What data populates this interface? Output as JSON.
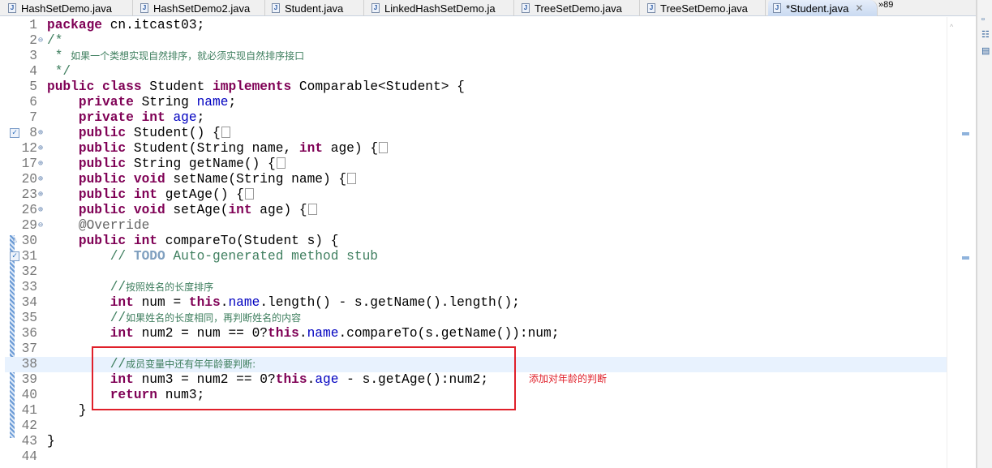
{
  "tabs": [
    {
      "label": "HashSetDemo.java",
      "active": false
    },
    {
      "label": "HashSetDemo2.java",
      "active": false
    },
    {
      "label": "Student.java",
      "active": false
    },
    {
      "label": "LinkedHashSetDemo.ja",
      "active": false
    },
    {
      "label": "TreeSetDemo.java",
      "active": false
    },
    {
      "label": "TreeSetDemo.java",
      "active": false
    },
    {
      "label": "*Student.java",
      "active": true
    }
  ],
  "overflow": {
    "chevron": "»",
    "count": "89"
  },
  "annotation": "添加对年龄的判断",
  "colors": {
    "highlight_box": "#e0202a",
    "keyword": "#7f0055",
    "comment": "#3f7f5f",
    "field": "#0000c0"
  },
  "lines": [
    {
      "num": "1",
      "seg": [
        [
          "kw",
          "package"
        ],
        [
          "pl",
          " cn.itcast03;"
        ]
      ]
    },
    {
      "num": "2",
      "fold": "minus",
      "seg": [
        [
          "cm",
          "/*"
        ]
      ]
    },
    {
      "num": "3",
      "seg": [
        [
          "cm",
          " * "
        ],
        [
          "cn",
          "如果一个类想实现自然排序，就必须实现自然排序接口"
        ]
      ]
    },
    {
      "num": "4",
      "seg": [
        [
          "cm",
          " */"
        ]
      ]
    },
    {
      "num": "5",
      "seg": [
        [
          "kw",
          "public class"
        ],
        [
          "pl",
          " Student "
        ],
        [
          "kw",
          "implements"
        ],
        [
          "pl",
          " Comparable<Student> {"
        ]
      ]
    },
    {
      "num": "6",
      "seg": [
        [
          "pl",
          "    "
        ],
        [
          "kw",
          "private"
        ],
        [
          "pl",
          " String "
        ],
        [
          "fld",
          "name"
        ],
        [
          "pl",
          ";"
        ]
      ]
    },
    {
      "num": "7",
      "seg": [
        [
          "pl",
          "    "
        ],
        [
          "kw",
          "private int"
        ],
        [
          "pl",
          " "
        ],
        [
          "fld",
          "age"
        ],
        [
          "pl",
          ";"
        ]
      ]
    },
    {
      "num": "8",
      "fold": "plus",
      "marker": "check",
      "seg": [
        [
          "pl",
          "    "
        ],
        [
          "kw",
          "public"
        ],
        [
          "pl",
          " Student() {"
        ],
        [
          "box",
          ""
        ]
      ]
    },
    {
      "num": "12",
      "fold": "plus",
      "seg": [
        [
          "pl",
          "    "
        ],
        [
          "kw",
          "public"
        ],
        [
          "pl",
          " Student(String name, "
        ],
        [
          "kw",
          "int"
        ],
        [
          "pl",
          " age) {"
        ],
        [
          "box",
          ""
        ]
      ]
    },
    {
      "num": "17",
      "fold": "plus",
      "seg": [
        [
          "pl",
          "    "
        ],
        [
          "kw",
          "public"
        ],
        [
          "pl",
          " String getName() {"
        ],
        [
          "box",
          ""
        ]
      ]
    },
    {
      "num": "20",
      "fold": "plus",
      "seg": [
        [
          "pl",
          "    "
        ],
        [
          "kw",
          "public void"
        ],
        [
          "pl",
          " setName(String name) {"
        ],
        [
          "box",
          ""
        ]
      ]
    },
    {
      "num": "23",
      "fold": "plus",
      "seg": [
        [
          "pl",
          "    "
        ],
        [
          "kw",
          "public int"
        ],
        [
          "pl",
          " getAge() {"
        ],
        [
          "box",
          ""
        ]
      ]
    },
    {
      "num": "26",
      "fold": "plus",
      "seg": [
        [
          "pl",
          "    "
        ],
        [
          "kw",
          "public void"
        ],
        [
          "pl",
          " setAge("
        ],
        [
          "kw",
          "int"
        ],
        [
          "pl",
          " age) {"
        ],
        [
          "box",
          ""
        ]
      ]
    },
    {
      "num": "29",
      "fold": "minus",
      "seg": [
        [
          "ann",
          "    @Override"
        ]
      ]
    },
    {
      "num": "30",
      "marker": "override",
      "seg": [
        [
          "pl",
          "    "
        ],
        [
          "kw",
          "public int"
        ],
        [
          "pl",
          " compareTo(Student s) {"
        ]
      ]
    },
    {
      "num": "31",
      "marker": "check",
      "seg": [
        [
          "cm",
          "        // "
        ],
        [
          "todo",
          "TODO"
        ],
        [
          "cm",
          " Auto-generated method stub"
        ]
      ]
    },
    {
      "num": "32",
      "seg": []
    },
    {
      "num": "33",
      "seg": [
        [
          "cm",
          "        //"
        ],
        [
          "cn",
          "按照姓名的长度排序"
        ]
      ]
    },
    {
      "num": "34",
      "seg": [
        [
          "pl",
          "        "
        ],
        [
          "kw",
          "int"
        ],
        [
          "pl",
          " num = "
        ],
        [
          "kw",
          "this"
        ],
        [
          "pl",
          "."
        ],
        [
          "fld",
          "name"
        ],
        [
          "pl",
          ".length() - s.getName().length();"
        ]
      ]
    },
    {
      "num": "35",
      "seg": [
        [
          "cm",
          "        //"
        ],
        [
          "cn",
          "如果姓名的长度相同，再判断姓名的内容"
        ]
      ]
    },
    {
      "num": "36",
      "seg": [
        [
          "pl",
          "        "
        ],
        [
          "kw",
          "int"
        ],
        [
          "pl",
          " num2 = num == 0?"
        ],
        [
          "kw",
          "this"
        ],
        [
          "pl",
          "."
        ],
        [
          "fld",
          "name"
        ],
        [
          "pl",
          ".compareTo(s.getName()):num;"
        ]
      ]
    },
    {
      "num": "37",
      "seg": []
    },
    {
      "num": "38",
      "current": true,
      "seg": [
        [
          "cm",
          "        //"
        ],
        [
          "cn",
          "成员变量中还有年年龄要判断:"
        ]
      ]
    },
    {
      "num": "39",
      "seg": [
        [
          "pl",
          "        "
        ],
        [
          "kw",
          "int"
        ],
        [
          "pl",
          " num3 = num2 == 0?"
        ],
        [
          "kw",
          "this"
        ],
        [
          "pl",
          "."
        ],
        [
          "fld",
          "age"
        ],
        [
          "pl",
          " - s.getAge():num2;"
        ]
      ]
    },
    {
      "num": "40",
      "seg": [
        [
          "pl",
          "        "
        ],
        [
          "kw",
          "return"
        ],
        [
          "pl",
          " num3;"
        ]
      ]
    },
    {
      "num": "41",
      "seg": [
        [
          "pl",
          "    }"
        ]
      ]
    },
    {
      "num": "42",
      "seg": []
    },
    {
      "num": "43",
      "seg": [
        [
          "pl",
          "}"
        ]
      ]
    },
    {
      "num": "44",
      "seg": []
    }
  ]
}
